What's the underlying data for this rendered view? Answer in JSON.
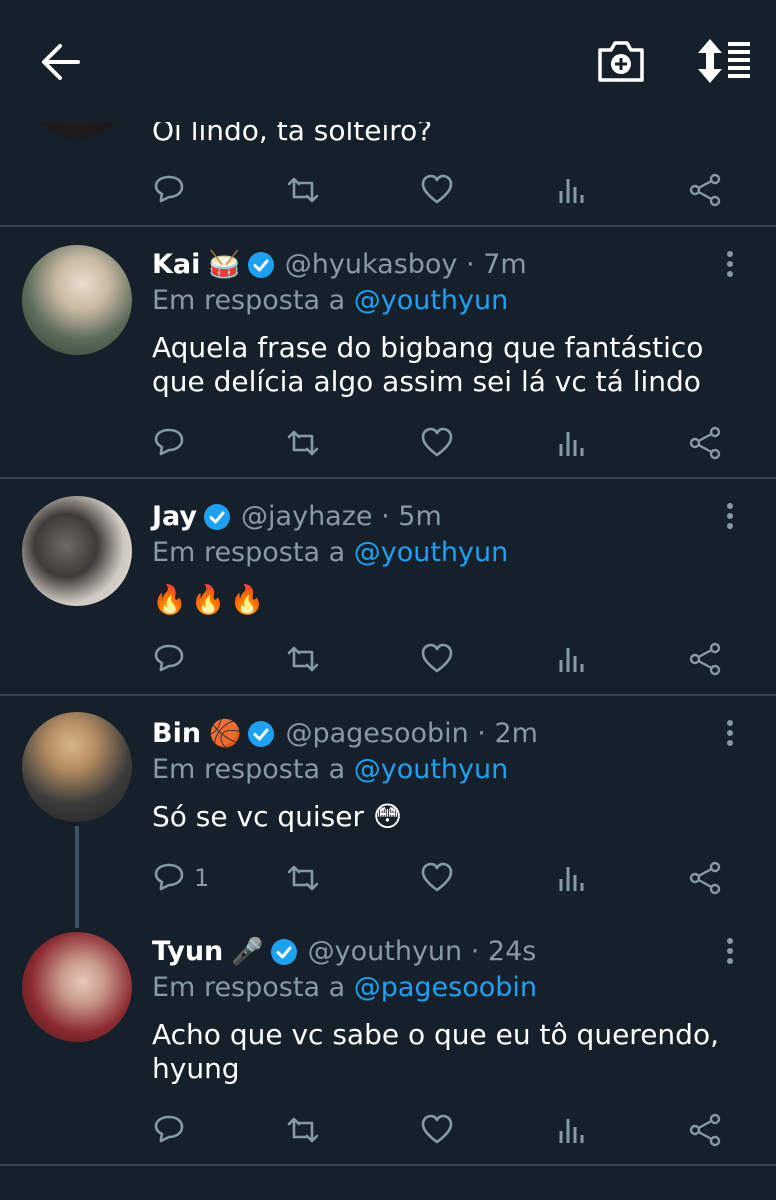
{
  "top_bar": {
    "back_icon": "arrow-left-icon",
    "camera_icon": "camera-plus-icon",
    "sort_icon": "sort-icon"
  },
  "tweets": [
    {
      "text": "Oi lindo, ta solteiro?"
    },
    {
      "name": "Kai",
      "emoji": "🥁",
      "handle": "@hyukasboy · 7m",
      "reply_prefix": "Em resposta a",
      "reply_to": "@youthyun",
      "text": "Aquela frase do bigbang que fantástico que delícia algo assim sei lá vc tá lindo"
    },
    {
      "name": "Jay",
      "handle": "@jayhaze · 5m",
      "reply_prefix": "Em resposta a",
      "reply_to": "@youthyun",
      "text": "🔥🔥🔥"
    },
    {
      "name": "Bin",
      "emoji": "🏀",
      "handle": "@pagesoobin · 2m",
      "reply_prefix": "Em resposta a",
      "reply_to": "@youthyun",
      "text": "Só se vc quiser 😳",
      "reply_count": "1"
    },
    {
      "name": "Tyun",
      "emoji": "🎤",
      "handle": "@youthyun · 24s",
      "reply_prefix": "Em resposta a",
      "reply_to": "@pagesoobin",
      "text": "Acho que vc sabe o que eu tô querendo, hyung"
    }
  ],
  "colors": {
    "background": "#15202b",
    "secondary_text": "#8899a6",
    "accent": "#1da1f2",
    "divider": "#38444d"
  }
}
